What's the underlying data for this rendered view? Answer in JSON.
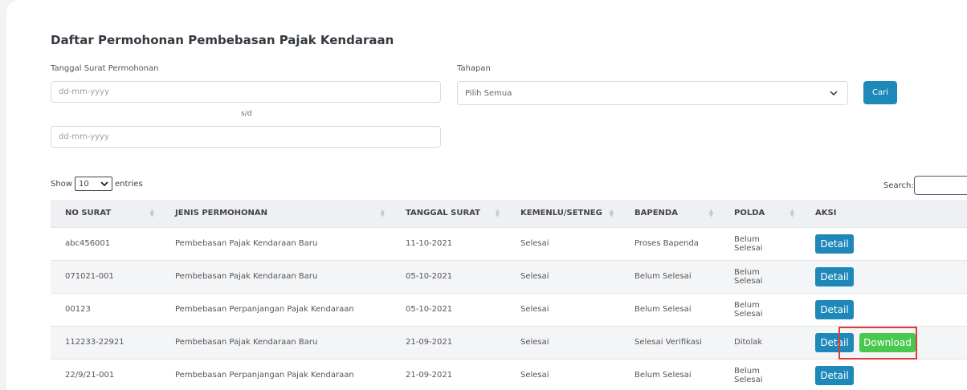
{
  "page": {
    "title": "Daftar Permohonan Pembebasan Pajak Kendaraan"
  },
  "filters": {
    "date_label": "Tanggal Surat Permohonan",
    "date_from_placeholder": "dd-mm-yyyy",
    "separator": "s/d",
    "date_to_placeholder": "dd-mm-yyyy",
    "stage_label": "Tahapan",
    "stage_selected": "Pilih Semua",
    "search_button": "Cari"
  },
  "datatable": {
    "show_label": "Show",
    "entries_value": "10",
    "entries_label": "entries",
    "search_label": "Search:"
  },
  "table": {
    "columns": [
      "NO SURAT",
      "JENIS PERMOHONAN",
      "TANGGAL SURAT",
      "KEMENLU/SETNEG",
      "BAPENDA",
      "POLDA",
      "AKSI"
    ],
    "detail_label": "Detail",
    "download_label": "Download",
    "rows": [
      {
        "no": "abc456001",
        "jenis": "Pembebasan Pajak Kendaraan Baru",
        "tanggal": "11-10-2021",
        "kemenlu": "Selesai",
        "bapenda": "Proses Bapenda",
        "polda": "Belum Selesai",
        "download": false
      },
      {
        "no": "071021-001",
        "jenis": "Pembebasan Pajak Kendaraan Baru",
        "tanggal": "05-10-2021",
        "kemenlu": "Selesai",
        "bapenda": "Belum Selesai",
        "polda": "Belum Selesai",
        "download": false
      },
      {
        "no": "00123",
        "jenis": "Pembebasan Perpanjangan Pajak Kendaraan",
        "tanggal": "05-10-2021",
        "kemenlu": "Selesai",
        "bapenda": "Belum Selesai",
        "polda": "Belum Selesai",
        "download": false
      },
      {
        "no": "112233-22921",
        "jenis": "Pembebasan Pajak Kendaraan Baru",
        "tanggal": "21-09-2021",
        "kemenlu": "Selesai",
        "bapenda": "Selesai Verifikasi",
        "polda": "Ditolak",
        "download": true
      },
      {
        "no": "22/9/21-001",
        "jenis": "Pembebasan Perpanjangan Pajak Kendaraan",
        "tanggal": "21-09-2021",
        "kemenlu": "Selesai",
        "bapenda": "Belum Selesai",
        "polda": "Belum Selesai",
        "download": false
      }
    ]
  },
  "colors": {
    "primary": "#1e88b8",
    "success": "#48c84e",
    "highlight": "#e23b3b"
  }
}
